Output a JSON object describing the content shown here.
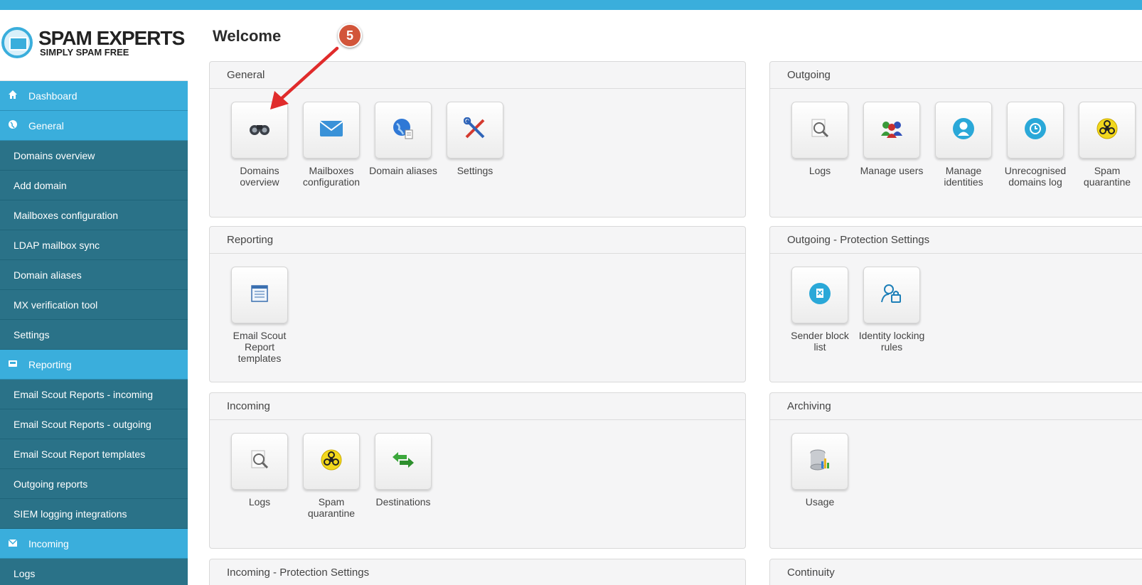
{
  "sidebar": {
    "logo": {
      "title": "SPAM EXPERTS",
      "subtitle": "SIMPLY SPAM FREE"
    },
    "items": [
      {
        "label": "Dashboard",
        "type": "section",
        "icon": "home-icon"
      },
      {
        "label": "General",
        "type": "section",
        "icon": "globe-icon"
      },
      {
        "label": "Domains overview",
        "type": "sub"
      },
      {
        "label": "Add domain",
        "type": "sub"
      },
      {
        "label": "Mailboxes configuration",
        "type": "sub"
      },
      {
        "label": "LDAP mailbox sync",
        "type": "sub"
      },
      {
        "label": "Domain aliases",
        "type": "sub"
      },
      {
        "label": "MX verification tool",
        "type": "sub"
      },
      {
        "label": "Settings",
        "type": "sub"
      },
      {
        "label": "Reporting",
        "type": "section",
        "icon": "inbox-icon"
      },
      {
        "label": "Email Scout Reports - incoming",
        "type": "sub"
      },
      {
        "label": "Email Scout Reports - outgoing",
        "type": "sub"
      },
      {
        "label": "Email Scout Report templates",
        "type": "sub"
      },
      {
        "label": "Outgoing reports",
        "type": "sub"
      },
      {
        "label": "SIEM logging integrations",
        "type": "sub"
      },
      {
        "label": "Incoming",
        "type": "section",
        "icon": "envelope-icon"
      },
      {
        "label": "Logs",
        "type": "sub"
      }
    ]
  },
  "main": {
    "title": "Welcome",
    "annotation": {
      "step": "5"
    },
    "panels": {
      "general": {
        "title": "General",
        "tiles": [
          {
            "label1": "Domains",
            "label2": "overview",
            "icon": "binoculars-icon"
          },
          {
            "label1": "Mailboxes",
            "label2": "configuration",
            "icon": "envelope-icon"
          },
          {
            "label1": "Domain aliases",
            "label2": "",
            "icon": "globe-document-icon"
          },
          {
            "label1": "Settings",
            "label2": "",
            "icon": "tools-icon"
          }
        ]
      },
      "outgoing": {
        "title": "Outgoing",
        "tiles": [
          {
            "label1": "Logs",
            "label2": "",
            "icon": "magnifier-icon"
          },
          {
            "label1": "Manage users",
            "label2": "",
            "icon": "users-icon"
          },
          {
            "label1": "Manage",
            "label2": "identities",
            "icon": "user-circle-icon"
          },
          {
            "label1": "Unrecognised",
            "label2": "domains log",
            "icon": "clock-icon"
          },
          {
            "label1": "Spam",
            "label2": "quarantine",
            "icon": "biohazard-icon"
          }
        ]
      },
      "reporting": {
        "title": "Reporting",
        "tiles": [
          {
            "label1": "Email Scout",
            "label2": "Report",
            "label3": "templates",
            "icon": "report-icon"
          }
        ]
      },
      "outgoing_protection": {
        "title": "Outgoing - Protection Settings",
        "tiles": [
          {
            "label1": "Sender block",
            "label2": "list",
            "icon": "block-icon"
          },
          {
            "label1": "Identity locking",
            "label2": "rules",
            "icon": "user-lock-icon"
          }
        ]
      },
      "incoming": {
        "title": "Incoming",
        "tiles": [
          {
            "label1": "Logs",
            "label2": "",
            "icon": "magnifier-icon"
          },
          {
            "label1": "Spam",
            "label2": "quarantine",
            "icon": "biohazard-icon"
          },
          {
            "label1": "Destinations",
            "label2": "",
            "icon": "arrows-icon"
          }
        ]
      },
      "archiving": {
        "title": "Archiving",
        "tiles": [
          {
            "label1": "Usage",
            "label2": "",
            "icon": "database-chart-icon"
          }
        ]
      },
      "incoming_protection": {
        "title": "Incoming - Protection Settings"
      },
      "continuity": {
        "title": "Continuity"
      }
    }
  }
}
